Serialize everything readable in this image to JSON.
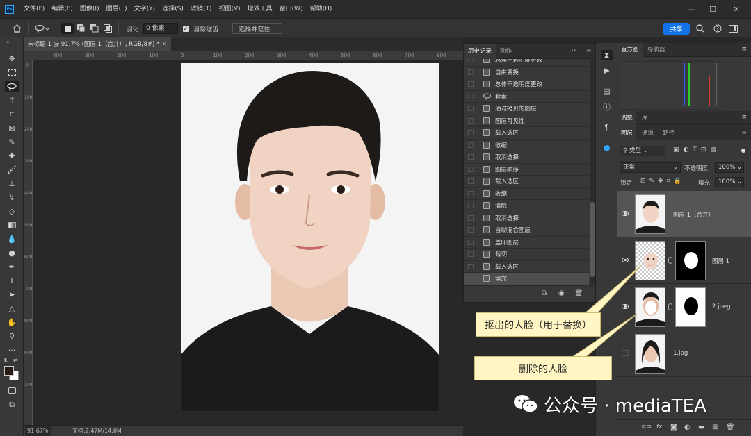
{
  "menubar": {
    "logo": "Ps",
    "items": [
      "文件(F)",
      "编辑(E)",
      "图像(I)",
      "图层(L)",
      "文字(Y)",
      "选择(S)",
      "滤镜(T)",
      "视图(V)",
      "增效工具",
      "窗口(W)",
      "帮助(H)"
    ]
  },
  "options": {
    "feather_label": "羽化:",
    "feather_value": "0 像素",
    "antialias_label": "消除锯齿",
    "select_mask_button": "选择并遮住...",
    "share_button": "共享"
  },
  "document": {
    "tab_title": "未标题-1 @ 91.7% (图层 1（合并）, RGB/8#) *",
    "h_ruler": [
      "400",
      "300",
      "200",
      "100",
      "0",
      "100",
      "200",
      "300",
      "400",
      "500",
      "600",
      "700",
      "800"
    ],
    "v_ruler": [
      "0",
      "100",
      "200",
      "300",
      "400",
      "500",
      "600",
      "700",
      "800",
      "900",
      "1000"
    ],
    "zoom": "91.67%",
    "doc_info": "文档:2.47M/14.0M"
  },
  "history": {
    "tabs": [
      "历史记录",
      "动作"
    ],
    "items": [
      {
        "label": "总体不透明度更改",
        "icon": "history-step-icon"
      },
      {
        "label": "自由变换",
        "icon": "history-step-icon"
      },
      {
        "label": "总体不透明度更改",
        "icon": "history-step-icon"
      },
      {
        "label": "套索",
        "icon": "lasso-icon"
      },
      {
        "label": "通过拷贝的图层",
        "icon": "history-step-icon"
      },
      {
        "label": "图层可见性",
        "icon": "history-step-icon"
      },
      {
        "label": "载入选区",
        "icon": "history-step-icon"
      },
      {
        "label": "收缩",
        "icon": "history-step-icon"
      },
      {
        "label": "取消选择",
        "icon": "history-step-icon"
      },
      {
        "label": "图层顺序",
        "icon": "history-step-icon"
      },
      {
        "label": "载入选区",
        "icon": "history-step-icon"
      },
      {
        "label": "收缩",
        "icon": "history-step-icon"
      },
      {
        "label": "清除",
        "icon": "history-step-icon"
      },
      {
        "label": "取消选择",
        "icon": "history-step-icon"
      },
      {
        "label": "自动混合图层",
        "icon": "history-step-icon"
      },
      {
        "label": "盖印图层",
        "icon": "history-step-icon"
      },
      {
        "label": "裁切",
        "icon": "history-step-icon"
      },
      {
        "label": "载入选区",
        "icon": "history-step-icon"
      },
      {
        "label": "填充",
        "icon": "history-step-icon"
      }
    ]
  },
  "histogram_panel": {
    "tabs": [
      "直方图",
      "导航器"
    ]
  },
  "adjust_panel": {
    "tabs": [
      "调整",
      "库"
    ]
  },
  "layers_panel": {
    "tabs": [
      "图层",
      "通道",
      "路径"
    ],
    "filter_type": "类型",
    "blend_mode": "正常",
    "opacity_label": "不透明度:",
    "opacity_value": "100%",
    "lock_label": "锁定:",
    "fill_label": "填充:",
    "fill_value": "100%",
    "layers": [
      {
        "name": "图层 1（合并）",
        "visible": true,
        "selected": true
      },
      {
        "name": "图层 1",
        "visible": true,
        "selected": false
      },
      {
        "name": "2.jpeg",
        "visible": true,
        "selected": false
      },
      {
        "name": "1.jpg",
        "visible": false,
        "selected": false
      }
    ]
  },
  "annotations": {
    "callout_face_cutout": "抠出的人脸（用于替换）",
    "callout_face_removed": "删除的人脸"
  },
  "watermark": {
    "text": "公众号 · mediaTEA"
  },
  "colors": {
    "accent": "#1473e6",
    "callout_bg": "#fff6c4",
    "panel_bg": "#383838"
  }
}
